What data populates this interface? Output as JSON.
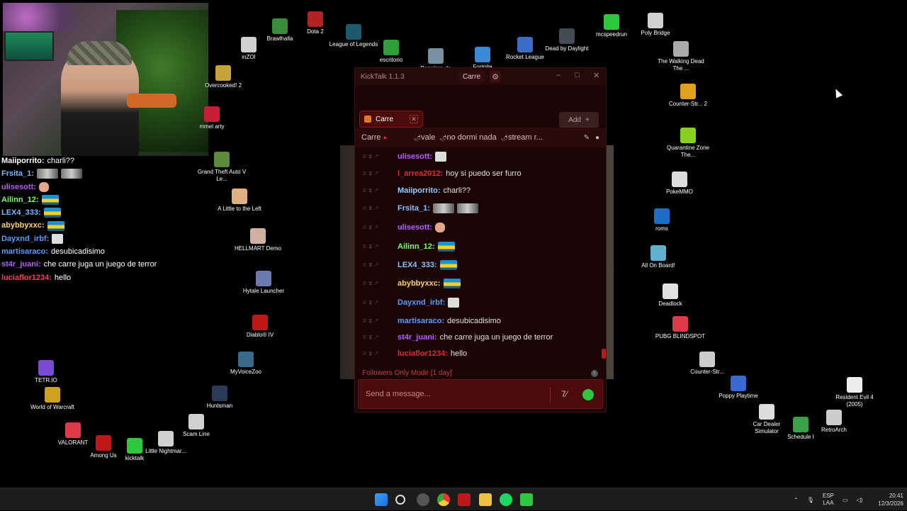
{
  "overlay_chat": [
    {
      "user": "Maiiporrito:",
      "color": "#ffffff",
      "text": "charli??",
      "emotes": []
    },
    {
      "user": "Frsita_1:",
      "color": "#7ab6ff",
      "text": "",
      "emotes": [
        "cat",
        "cat"
      ]
    },
    {
      "user": "ulisesott:",
      "color": "#b65cff",
      "text": "",
      "emotes": [
        "hand"
      ]
    },
    {
      "user": "Ailinn_12:",
      "color": "#7cff5a",
      "text": "",
      "emotes": [
        "car"
      ]
    },
    {
      "user": "LEX4_333:",
      "color": "#7ab6ff",
      "text": "",
      "emotes": [
        "car"
      ]
    },
    {
      "user": "abybbyxxc:",
      "color": "#ffd166",
      "text": "",
      "emotes": [
        "car"
      ]
    },
    {
      "user": "Dayxnd_irbf:",
      "color": "#5a9cff",
      "text": "",
      "emotes": [
        "white"
      ]
    },
    {
      "user": "martisaraco:",
      "color": "#5a9cff",
      "text": "desubicadisimo",
      "emotes": []
    },
    {
      "user": "st4r_juani:",
      "color": "#b65cff",
      "text": "che carre juga un juego de terror",
      "emotes": []
    },
    {
      "user": "luciaflor1234:",
      "color": "#ff3c5a",
      "text": "hello",
      "emotes": []
    }
  ],
  "desktop_icons": [
    {
      "label": "Brawlhalla",
      "color": "#3a8c3a"
    },
    {
      "label": "Dota 2",
      "color": "#b22222"
    },
    {
      "label": "League of Legends",
      "color": "#1e5a6e"
    },
    {
      "label": "escritorio",
      "color": "#2e9e3a"
    },
    {
      "label": "Papelera de",
      "color": "#7a8fa0"
    },
    {
      "label": "Fortnite",
      "color": "#3a8ad8"
    },
    {
      "label": "Rocket League",
      "color": "#3c6ec8"
    },
    {
      "label": "Dead by Daylight",
      "color": "#444b55"
    },
    {
      "label": "mcspeedrun",
      "color": "#2ec73e"
    },
    {
      "label": "Poly Bridge",
      "color": "#d0d0d0"
    },
    {
      "label": "inZOI",
      "color": "#d0d0d0"
    },
    {
      "label": "Overcooked! 2",
      "color": "#c8a23a"
    },
    {
      "label": "mmel arty",
      "color": "#c81e3a"
    },
    {
      "label": "Grand Theft Auto V Le...",
      "color": "#5a8a3a"
    },
    {
      "label": "A Little to the Left",
      "color": "#e0b080"
    },
    {
      "label": "HELLMART Demo",
      "color": "#d0b0a0"
    },
    {
      "label": "Hytale Launcher",
      "color": "#6a7ab0"
    },
    {
      "label": "Diablo® IV",
      "color": "#c01818"
    },
    {
      "label": "MyVoiceZoo",
      "color": "#3a6a8a"
    },
    {
      "label": "TETR.IO",
      "color": "#7a4ad0"
    },
    {
      "label": "World of Warcraft",
      "color": "#d0a020"
    },
    {
      "label": "Huntsman",
      "color": "#2a3a5a"
    },
    {
      "label": "VALORANT",
      "color": "#e03a4a"
    },
    {
      "label": "Among Us",
      "color": "#c01818"
    },
    {
      "label": "kicktalk",
      "color": "#2ec73e"
    },
    {
      "label": "Little Nightmar...",
      "color": "#d0d0d0"
    },
    {
      "label": "Scam Line",
      "color": "#d0d0d0"
    },
    {
      "label": "The Walking Dead The ...",
      "color": "#aaaaaa"
    },
    {
      "label": "Counter-Str... 2",
      "color": "#e0a020"
    },
    {
      "label": "Quarantine Zone The...",
      "color": "#8ad020"
    },
    {
      "label": "PokeMMO",
      "color": "#dddddd"
    },
    {
      "label": "roms",
      "color": "#1e6ec8"
    },
    {
      "label": "All On Board!",
      "color": "#60b0d0"
    },
    {
      "label": "Deadlock",
      "color": "#e0e0e0"
    },
    {
      "label": "PUBG BLINDSPOT",
      "color": "#e03a4a"
    },
    {
      "label": "Counter-Str...",
      "color": "#cccccc"
    },
    {
      "label": "Poppy Playtime",
      "color": "#3a6ad0"
    },
    {
      "label": "Car Dealer Simulator",
      "color": "#dddddd"
    },
    {
      "label": "Schedule I",
      "color": "#3aa04a"
    },
    {
      "label": "RetroArch",
      "color": "#cccccc"
    },
    {
      "label": "Resident Evil 4 (2005)",
      "color": "#eeeeee"
    }
  ],
  "kicktalk": {
    "title": "KickTalk 1.1.3",
    "channel_select": "Carre",
    "tab_label": "Carre",
    "add_label": "Add",
    "pinned_channel": "Carre",
    "pinned_items": [
      "vale",
      "no dormi nada",
      "stream r..."
    ],
    "messages": [
      {
        "user": "ulisesott:",
        "color": "#b65cff",
        "text": "",
        "emote": "white"
      },
      {
        "user": "l_arrea2012:",
        "color": "#e0283a",
        "text": "hoy si puedo ser furro",
        "emote": ""
      },
      {
        "user": "Maiiporrito:",
        "color": "#8fd0ff",
        "text": "charli??",
        "emote": ""
      },
      {
        "user": "Frsita_1:",
        "color": "#8fc0ff",
        "text": "",
        "emote": "cat2"
      },
      {
        "user": "ulisesott:",
        "color": "#b65cff",
        "text": "",
        "emote": "hand"
      },
      {
        "user": "Ailinn_12:",
        "color": "#7cff5a",
        "text": "",
        "emote": "car"
      },
      {
        "user": "LEX4_333:",
        "color": "#8fc0ff",
        "text": "",
        "emote": "car"
      },
      {
        "user": "abybbyxxc:",
        "color": "#ffd166",
        "text": "",
        "emote": "car"
      },
      {
        "user": "Dayxnd_irbf:",
        "color": "#5a9cff",
        "text": "",
        "emote": "white"
      },
      {
        "user": "martisaraco:",
        "color": "#5a9cff",
        "text": "desubicadisimo",
        "emote": ""
      },
      {
        "user": "st4r_juani:",
        "color": "#b65cff",
        "text": "che carre juga un juego de terror",
        "emote": ""
      },
      {
        "user": "luciaflor1234:",
        "color": "#e0283a",
        "text": "hello",
        "emote": ""
      }
    ],
    "followers_notice": "Followers Only Mode [1 day]",
    "input_placeholder": "Send a message..."
  },
  "taskbar": {
    "lang_top": "ESP",
    "lang_bottom": "LAA",
    "time": "20:41",
    "date": "12/3/2026"
  }
}
